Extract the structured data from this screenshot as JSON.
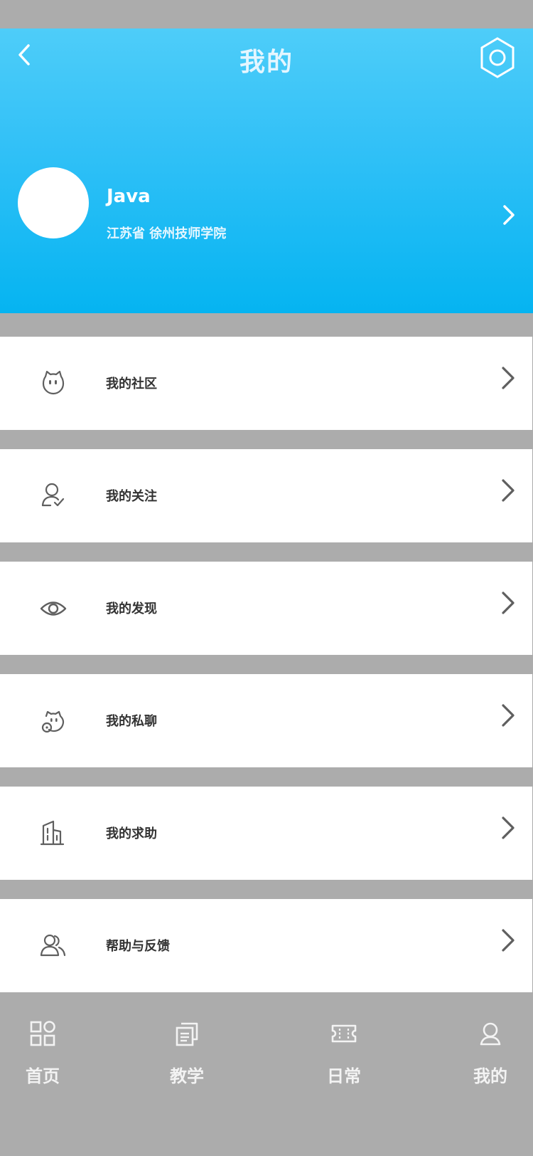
{
  "header": {
    "title": "我的",
    "user": {
      "name": "Java",
      "school": "江苏省 徐州技师学院"
    }
  },
  "menu": [
    {
      "label": "我的社区",
      "icon": "face-icon"
    },
    {
      "label": "我的关注",
      "icon": "user-check-icon"
    },
    {
      "label": "我的发现",
      "icon": "eye-icon"
    },
    {
      "label": "我的私聊",
      "icon": "chat-face-icon"
    },
    {
      "label": "我的求助",
      "icon": "building-icon"
    },
    {
      "label": "帮助与反馈",
      "icon": "users-icon"
    }
  ],
  "tabbar": [
    {
      "label": "首页",
      "icon": "grid-icon"
    },
    {
      "label": "教学",
      "icon": "book-icon"
    },
    {
      "label": "日常",
      "icon": "ticket-icon"
    },
    {
      "label": "我的",
      "icon": "person-icon"
    }
  ],
  "colors": {
    "header_top": "#4ecdf9",
    "header_bottom": "#05b4f1",
    "page_bg": "#acacac",
    "icon_gray": "#5f5f5f"
  }
}
